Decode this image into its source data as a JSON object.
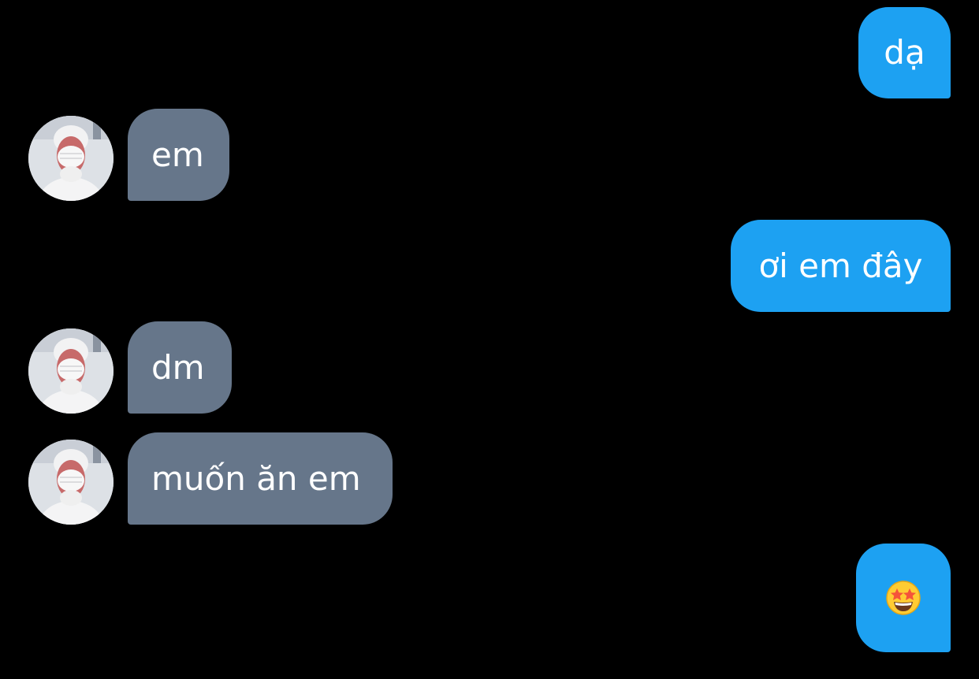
{
  "conversation": {
    "messages": [
      {
        "sender": "me",
        "text": "dạ"
      },
      {
        "sender": "other",
        "text": "em"
      },
      {
        "sender": "me",
        "text": "ơi em đây"
      },
      {
        "sender": "other",
        "text": "dm"
      },
      {
        "sender": "other",
        "text": "muốn ăn em"
      },
      {
        "sender": "me",
        "emoji": "star-struck-emoji"
      }
    ]
  },
  "colors": {
    "background": "#000000",
    "sent_bubble": "#1da1f2",
    "received_bubble": "#66768a",
    "text": "#ffffff"
  }
}
